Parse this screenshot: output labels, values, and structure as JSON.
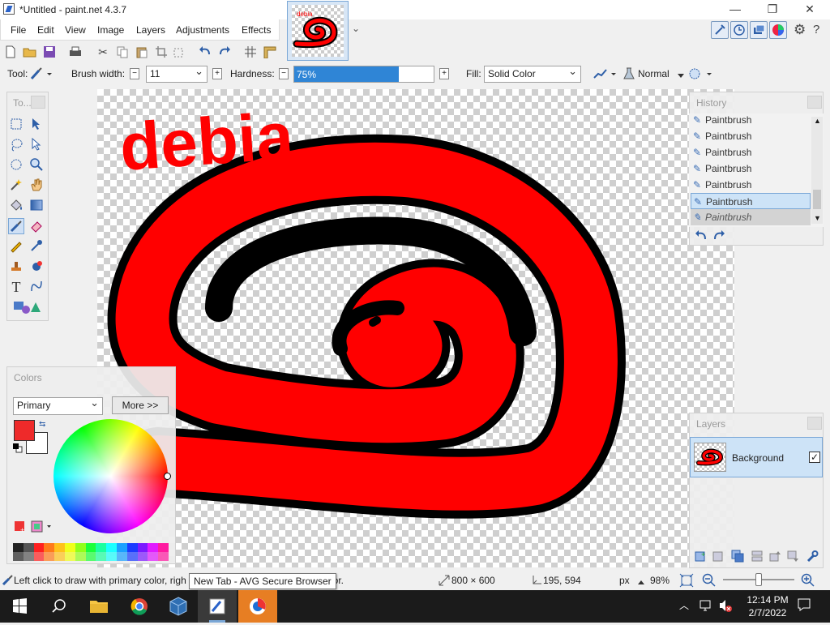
{
  "window": {
    "title": "*Untitled - paint.net 4.3.7",
    "minimize_glyph": "—",
    "restore_glyph": "❐",
    "close_glyph": "✕"
  },
  "menu": [
    "File",
    "Edit",
    "View",
    "Image",
    "Layers",
    "Adjustments",
    "Effects"
  ],
  "image_tab": {
    "expand_glyph": "⌄"
  },
  "toolbar": {
    "tool_label": "Tool:",
    "brush_width_label": "Brush width:",
    "brush_width_value": "11",
    "hardness_label": "Hardness:",
    "hardness_value": "75%",
    "hardness_fraction": 0.75,
    "fill_label": "Fill:",
    "fill_value": "Solid Color",
    "blend_mode": "Normal"
  },
  "canvas": {
    "text": "debia",
    "accent_colors": {
      "stroke": "#000000",
      "fill": "#ff0000"
    }
  },
  "tools_panel": {
    "title": "To...",
    "tools": [
      "rectangle-select",
      "move-selection",
      "lasso-select",
      "move-selection-only",
      "ellipse-select",
      "zoom",
      "magic-wand",
      "pan",
      "paint-bucket",
      "gradient",
      "paintbrush",
      "eraser",
      "pencil",
      "color-picker",
      "clone-stamp",
      "recolor",
      "text",
      "line-curve",
      "shapes"
    ],
    "selected": "paintbrush"
  },
  "history_panel": {
    "title": "History",
    "items": [
      "Paintbrush",
      "Paintbrush",
      "Paintbrush",
      "Paintbrush",
      "Paintbrush",
      "Paintbrush",
      "Paintbrush"
    ],
    "selected_index": 5
  },
  "layers_panel": {
    "title": "Layers",
    "layers": [
      {
        "name": "Background",
        "visible": true
      }
    ]
  },
  "colors_panel": {
    "title": "Colors",
    "mode": "Primary",
    "more_button": "More >>",
    "primary": "#ee2a2a",
    "secondary": "#ffffff",
    "palette": [
      "#222222",
      "#555555",
      "#ff2020",
      "#ff7a1a",
      "#ffc21a",
      "#f0ff1a",
      "#90ff1a",
      "#1aff3a",
      "#1affa0",
      "#1affff",
      "#1aa0ff",
      "#1a3aff",
      "#7a1aff",
      "#e01aff",
      "#ff1aa0"
    ]
  },
  "status": {
    "hint": "Left click to draw with primary color, righ",
    "hint_tail": "lor.",
    "tooltip": "New Tab - AVG Secure Browser",
    "image_size": "800 × 600",
    "cursor_pos": "195, 594",
    "unit": "px",
    "zoom": "98%",
    "zoom_slider_fraction": 0.5
  },
  "taskbar": {
    "time": "12:14 PM",
    "date": "2/7/2022"
  }
}
